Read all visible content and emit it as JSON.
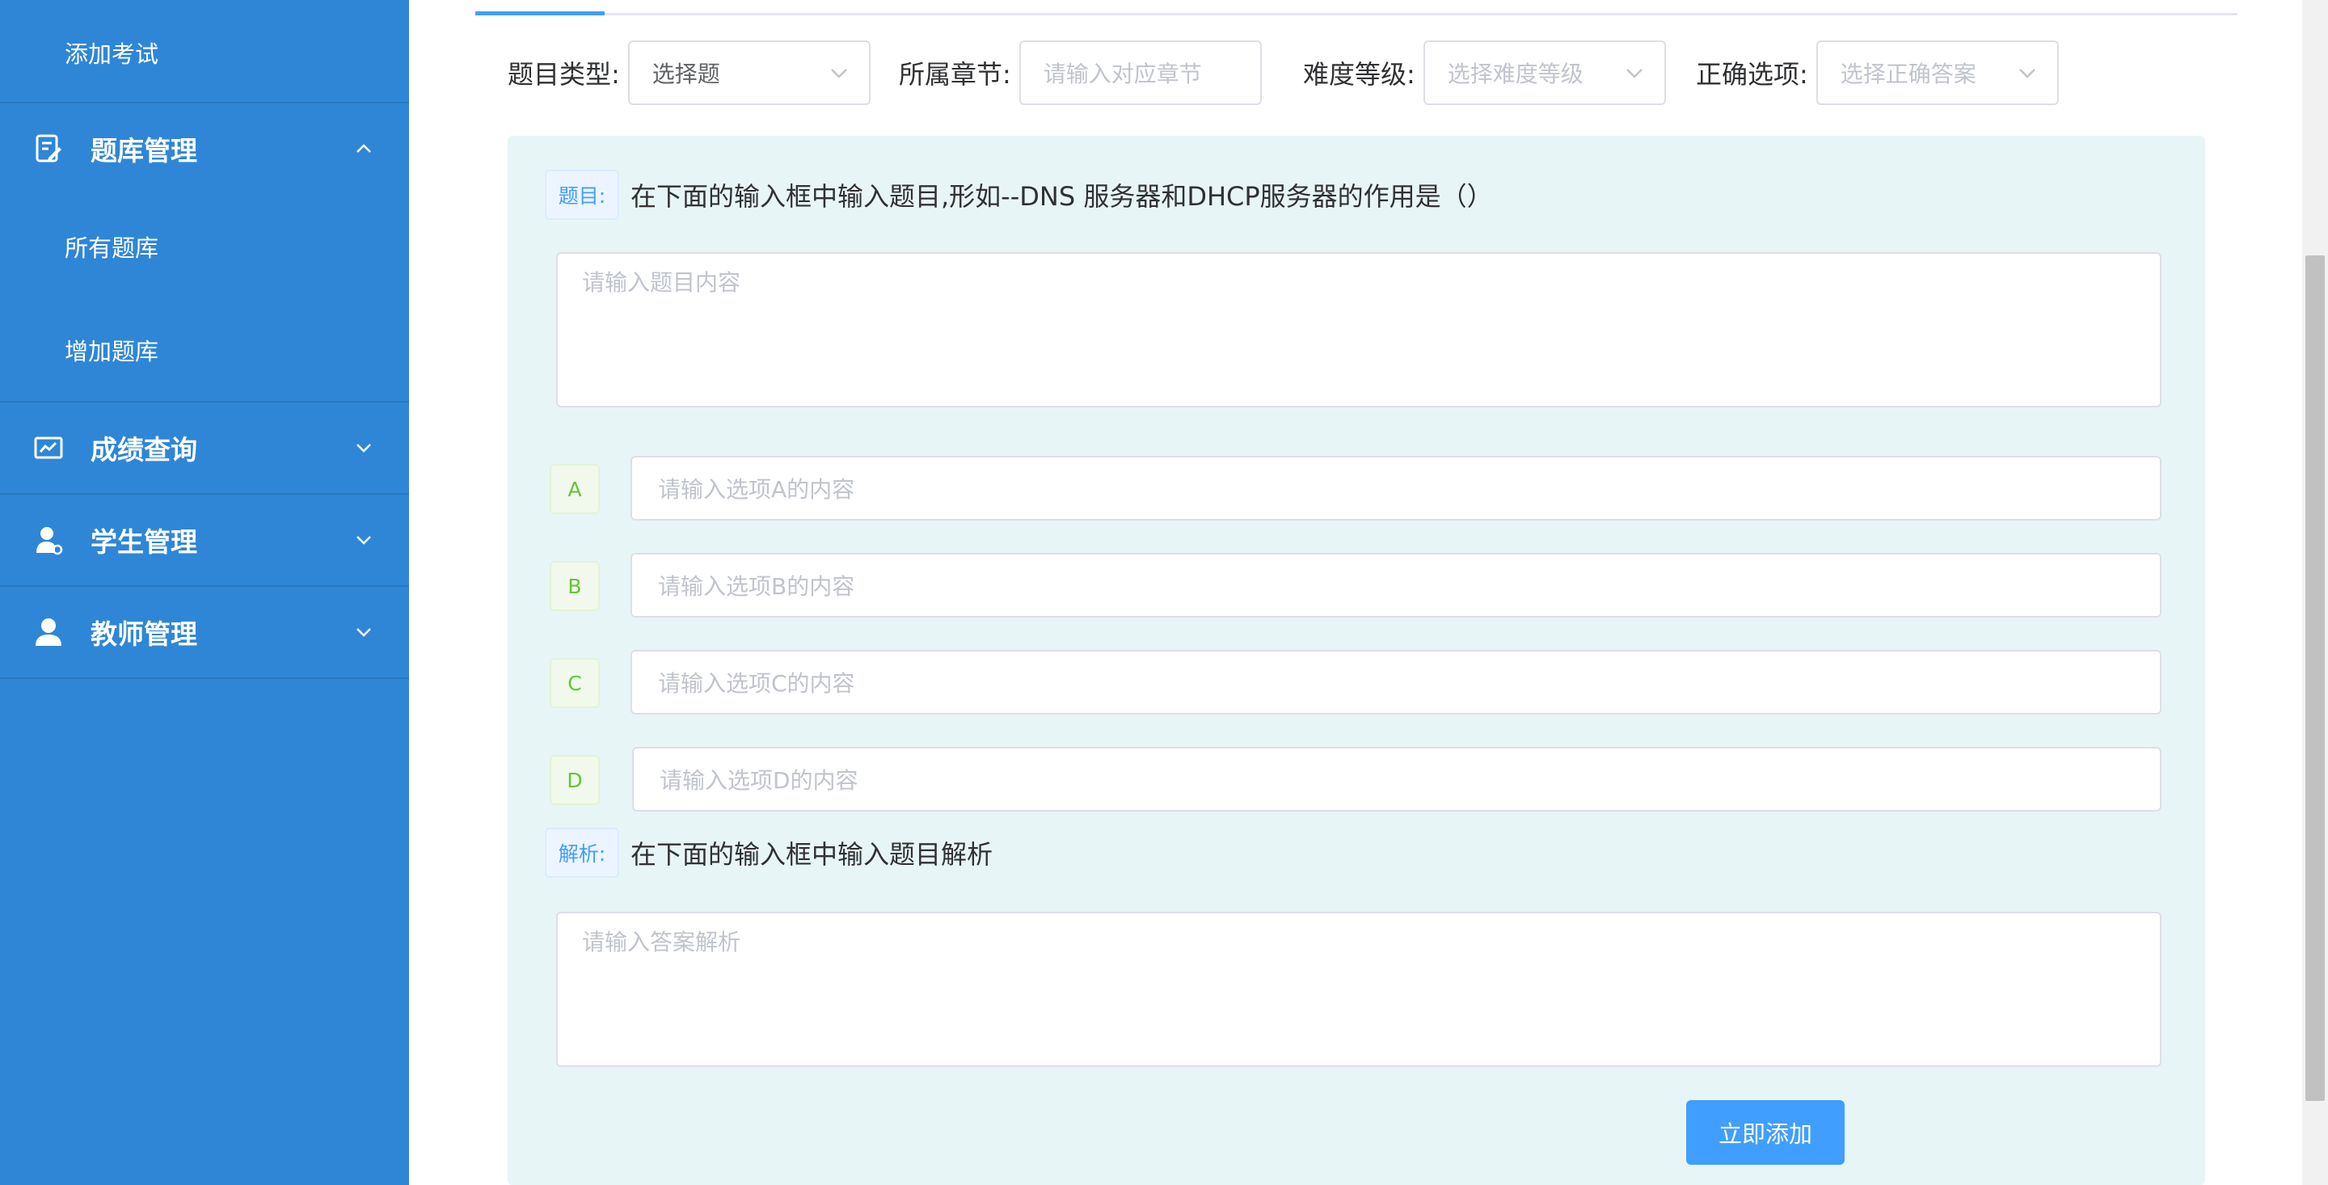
{
  "sidebar": {
    "top_item": "添加考试",
    "groups": [
      {
        "label": "题库管理",
        "icon": "edit-doc-icon",
        "expanded": true,
        "children": [
          "所有题库",
          "增加题库"
        ]
      },
      {
        "label": "成绩查询",
        "icon": "chart-card-icon",
        "expanded": false
      },
      {
        "label": "学生管理",
        "icon": "student-icon",
        "expanded": false
      },
      {
        "label": "教师管理",
        "icon": "user-icon",
        "expanded": false
      }
    ]
  },
  "filters": {
    "type": {
      "label": "题目类型:",
      "value": "选择题"
    },
    "chapter": {
      "label": "所属章节:",
      "placeholder": "请输入对应章节"
    },
    "difficulty": {
      "label": "难度等级:",
      "placeholder": "选择难度等级"
    },
    "answer": {
      "label": "正确选项:",
      "placeholder": "选择正确答案"
    }
  },
  "question": {
    "tag": "题目:",
    "hint": "在下面的输入框中输入题目,形如--DNS 服务器和DHCP服务器的作用是（）",
    "placeholder": "请输入题目内容"
  },
  "options": [
    {
      "letter": "A",
      "placeholder": "请输入选项A的内容"
    },
    {
      "letter": "B",
      "placeholder": "请输入选项B的内容"
    },
    {
      "letter": "C",
      "placeholder": "请输入选项C的内容"
    },
    {
      "letter": "D",
      "placeholder": "请输入选项D的内容"
    }
  ],
  "analysis": {
    "tag": "解析:",
    "hint": "在下面的输入框中输入题目解析",
    "placeholder": "请输入答案解析"
  },
  "submit_label": "立即添加",
  "colors": {
    "sidebar": "#2f86d6",
    "primary": "#409eff",
    "panel": "#e8f5f6",
    "option_tag": "#67c23a"
  }
}
